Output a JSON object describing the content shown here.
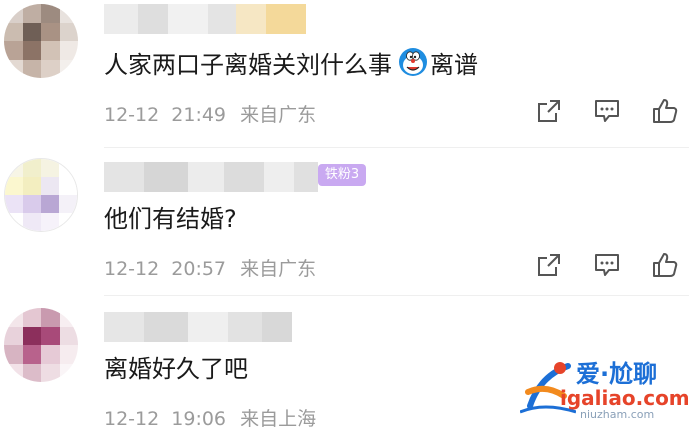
{
  "comments": [
    {
      "content_text": "人家两口子离婚关刘什么事",
      "emoji": "doraemon-face",
      "content_suffix": "离谱",
      "date": "12-12",
      "time": "21:49",
      "location": "来自广东"
    },
    {
      "fan_badge": "铁粉3",
      "content_text": "他们有结婚?",
      "date": "12-12",
      "time": "20:57",
      "location": "来自广东"
    },
    {
      "content_text": "离婚好久了吧",
      "date": "12-12",
      "time": "19:06",
      "location": "来自上海"
    }
  ],
  "actions": {
    "share_icon": "share-icon",
    "comment_icon": "comment-icon",
    "like_icon": "thumbs-up-icon"
  },
  "watermark": {
    "line1": "爱·尬聊",
    "line2": "igaliao.com",
    "line3": "niuzham.com"
  },
  "colors": {
    "text": "#1a1a1a",
    "meta": "#9b9b9b",
    "icon": "#555555",
    "badge": "#c9a9f1"
  }
}
